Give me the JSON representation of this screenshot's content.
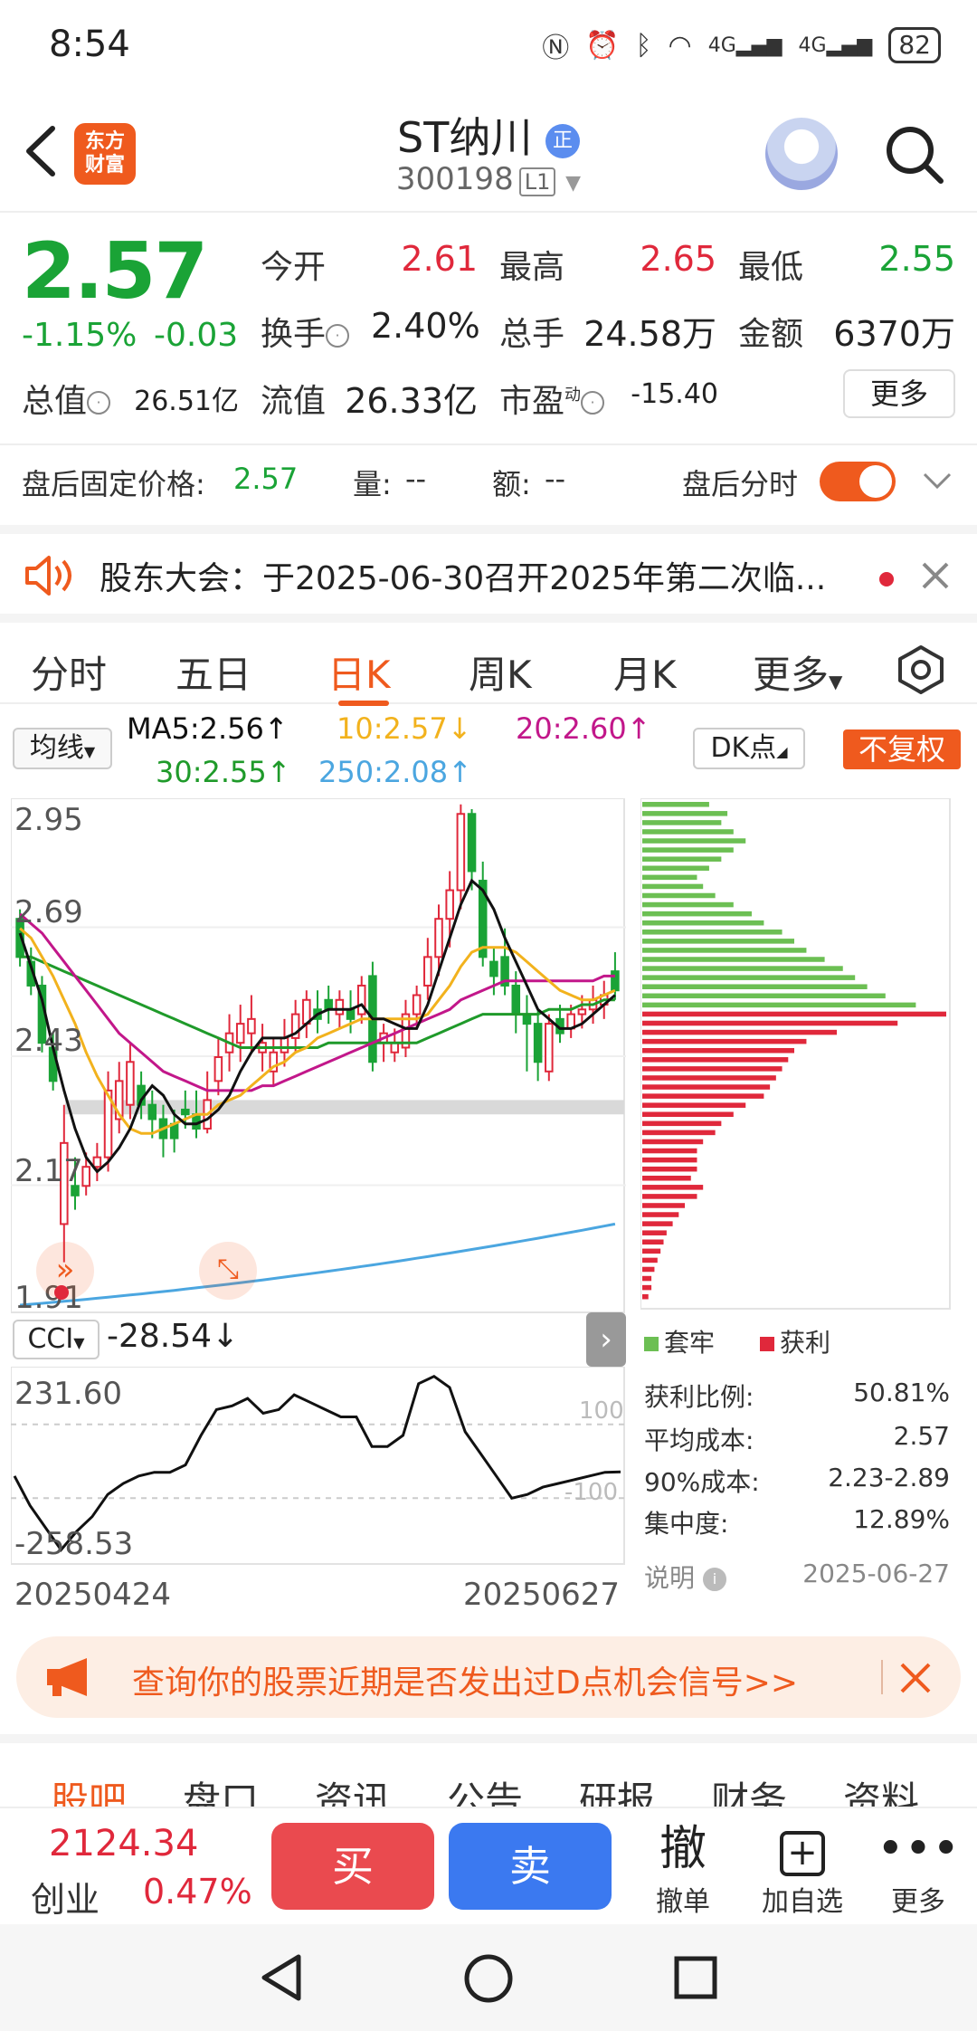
{
  "status_bar": {
    "time": "8:54",
    "signal1": "4G",
    "signal2": "4G",
    "battery": "82"
  },
  "header": {
    "logo_line1": "东方",
    "logo_line2": "财富",
    "stock_name": "ST纳川",
    "name_badge": "正",
    "stock_code": "300198",
    "code_badge": "L1"
  },
  "quote": {
    "price": "2.57",
    "pct": "-1.15%",
    "chg": "-0.03",
    "open_label": "今开",
    "open": "2.61",
    "high_label": "最高",
    "high": "2.65",
    "low_label": "最低",
    "low": "2.55",
    "turnover_label": "换手",
    "turnover": "2.40%",
    "volume_label": "总手",
    "volume": "24.58万",
    "amount_label": "金额",
    "amount": "6370万",
    "mktcap_label": "总值",
    "mktcap": "26.51亿",
    "float_label": "流值",
    "float": "26.33亿",
    "pe_label": "市盈",
    "pe_sup": "动",
    "pe": "-15.40",
    "more_label": "更多",
    "colors": {
      "up": "#e0283b",
      "down": "#1aa336",
      "accent": "#ef5a1e"
    }
  },
  "after_hours": {
    "price_label": "盘后固定价格:",
    "price": "2.57",
    "vol_label": "量:",
    "vol": "--",
    "amt_label": "额:",
    "amt": "--",
    "toggle_label": "盘后分时",
    "toggle_on": true
  },
  "notice": {
    "text": "股东大会：于2025-06-30召开2025年第二次临..."
  },
  "tabs": [
    "分时",
    "五日",
    "日K",
    "周K",
    "月K",
    "更多"
  ],
  "active_tab": "日K",
  "ma": {
    "selector": "均线",
    "ma5": "MA5:2.56↑",
    "ma10": "10:2.57↓",
    "ma20": "20:2.60↑",
    "ma30": "30:2.55↑",
    "ma250": "250:2.08↑",
    "dk_label": "DK点",
    "adjust_label": "不复权",
    "colors": {
      "ma5": "#111111",
      "ma10": "#f2b21d",
      "ma20": "#c2178a",
      "ma30": "#1f9a2a",
      "ma250": "#4ba6e0"
    }
  },
  "kline_axis": {
    "y_labels": [
      "2.95",
      "2.69",
      "2.43",
      "2.17",
      "1.91"
    ],
    "ylim": [
      1.91,
      2.95
    ]
  },
  "chart_data": {
    "type": "candlestick",
    "x_range": [
      "20250424",
      "20250627"
    ],
    "ylim": [
      1.91,
      2.95
    ],
    "candles": [
      {
        "o": 2.72,
        "h": 2.74,
        "c": 2.64,
        "l": 2.62
      },
      {
        "o": 2.63,
        "h": 2.66,
        "c": 2.58,
        "l": 2.56
      },
      {
        "o": 2.58,
        "h": 2.6,
        "c": 2.46,
        "l": 2.44
      },
      {
        "o": 2.45,
        "h": 2.48,
        "c": 2.38,
        "l": 2.36
      },
      {
        "o": 2.08,
        "h": 2.33,
        "c": 2.25,
        "l": 2.0
      },
      {
        "o": 2.16,
        "h": 2.22,
        "c": 2.14,
        "l": 2.11
      },
      {
        "o": 2.16,
        "h": 2.23,
        "c": 2.2,
        "l": 2.14
      },
      {
        "o": 2.2,
        "h": 2.25,
        "c": 2.22,
        "l": 2.17
      },
      {
        "o": 2.22,
        "h": 2.4,
        "c": 2.36,
        "l": 2.19
      },
      {
        "o": 2.3,
        "h": 2.42,
        "c": 2.38,
        "l": 2.27
      },
      {
        "o": 2.33,
        "h": 2.46,
        "c": 2.42,
        "l": 2.3
      },
      {
        "o": 2.37,
        "h": 2.4,
        "c": 2.33,
        "l": 2.3
      },
      {
        "o": 2.33,
        "h": 2.36,
        "c": 2.3,
        "l": 2.26
      },
      {
        "o": 2.3,
        "h": 2.33,
        "c": 2.26,
        "l": 2.22
      },
      {
        "o": 2.29,
        "h": 2.32,
        "c": 2.26,
        "l": 2.23
      },
      {
        "o": 2.32,
        "h": 2.36,
        "c": 2.31,
        "l": 2.28
      },
      {
        "o": 2.31,
        "h": 2.36,
        "c": 2.28,
        "l": 2.26
      },
      {
        "o": 2.28,
        "h": 2.4,
        "c": 2.34,
        "l": 2.27
      },
      {
        "o": 2.38,
        "h": 2.47,
        "c": 2.43,
        "l": 2.35
      },
      {
        "o": 2.44,
        "h": 2.52,
        "c": 2.48,
        "l": 2.4
      },
      {
        "o": 2.46,
        "h": 2.54,
        "c": 2.5,
        "l": 2.42
      },
      {
        "o": 2.48,
        "h": 2.56,
        "c": 2.51,
        "l": 2.44
      },
      {
        "o": 2.44,
        "h": 2.5,
        "c": 2.46,
        "l": 2.4
      },
      {
        "o": 2.4,
        "h": 2.47,
        "c": 2.44,
        "l": 2.37
      },
      {
        "o": 2.44,
        "h": 2.51,
        "c": 2.47,
        "l": 2.41
      },
      {
        "o": 2.47,
        "h": 2.55,
        "c": 2.52,
        "l": 2.44
      },
      {
        "o": 2.5,
        "h": 2.57,
        "c": 2.55,
        "l": 2.47
      },
      {
        "o": 2.53,
        "h": 2.57,
        "c": 2.51,
        "l": 2.48
      },
      {
        "o": 2.55,
        "h": 2.58,
        "c": 2.53,
        "l": 2.5
      },
      {
        "o": 2.52,
        "h": 2.57,
        "c": 2.55,
        "l": 2.49
      },
      {
        "o": 2.53,
        "h": 2.57,
        "c": 2.51,
        "l": 2.48
      },
      {
        "o": 2.52,
        "h": 2.6,
        "c": 2.58,
        "l": 2.5
      },
      {
        "o": 2.6,
        "h": 2.63,
        "c": 2.42,
        "l": 2.4
      },
      {
        "o": 2.46,
        "h": 2.5,
        "c": 2.48,
        "l": 2.42
      },
      {
        "o": 2.44,
        "h": 2.49,
        "c": 2.46,
        "l": 2.42
      },
      {
        "o": 2.45,
        "h": 2.55,
        "c": 2.52,
        "l": 2.43
      },
      {
        "o": 2.52,
        "h": 2.58,
        "c": 2.56,
        "l": 2.49
      },
      {
        "o": 2.58,
        "h": 2.68,
        "c": 2.64,
        "l": 2.55
      },
      {
        "o": 2.64,
        "h": 2.75,
        "c": 2.72,
        "l": 2.6
      },
      {
        "o": 2.72,
        "h": 2.82,
        "c": 2.78,
        "l": 2.66
      },
      {
        "o": 2.78,
        "h": 2.96,
        "c": 2.94,
        "l": 2.74
      },
      {
        "o": 2.94,
        "h": 2.95,
        "c": 2.82,
        "l": 2.78
      },
      {
        "o": 2.8,
        "h": 2.84,
        "c": 2.64,
        "l": 2.62
      },
      {
        "o": 2.63,
        "h": 2.66,
        "c": 2.6,
        "l": 2.56
      },
      {
        "o": 2.64,
        "h": 2.7,
        "c": 2.58,
        "l": 2.56
      },
      {
        "o": 2.58,
        "h": 2.61,
        "c": 2.52,
        "l": 2.48
      },
      {
        "o": 2.52,
        "h": 2.56,
        "c": 2.5,
        "l": 2.4
      },
      {
        "o": 2.5,
        "h": 2.53,
        "c": 2.42,
        "l": 2.38
      },
      {
        "o": 2.4,
        "h": 2.52,
        "c": 2.5,
        "l": 2.38
      },
      {
        "o": 2.51,
        "h": 2.54,
        "c": 2.48,
        "l": 2.46
      },
      {
        "o": 2.49,
        "h": 2.54,
        "c": 2.52,
        "l": 2.47
      },
      {
        "o": 2.52,
        "h": 2.56,
        "c": 2.53,
        "l": 2.49
      },
      {
        "o": 2.53,
        "h": 2.58,
        "c": 2.55,
        "l": 2.5
      },
      {
        "o": 2.54,
        "h": 2.59,
        "c": 2.56,
        "l": 2.51
      },
      {
        "o": 2.61,
        "h": 2.65,
        "c": 2.57,
        "l": 2.55
      }
    ],
    "ma5": [
      2.69,
      2.62,
      2.55,
      2.45,
      2.36,
      2.28,
      2.22,
      2.19,
      2.21,
      2.24,
      2.28,
      2.34,
      2.37,
      2.35,
      2.31,
      2.29,
      2.29,
      2.3,
      2.32,
      2.35,
      2.4,
      2.44,
      2.47,
      2.47,
      2.47,
      2.48,
      2.5,
      2.52,
      2.53,
      2.53,
      2.53,
      2.54,
      2.51,
      2.51,
      2.5,
      2.49,
      2.49,
      2.54,
      2.61,
      2.68,
      2.75,
      2.8,
      2.78,
      2.74,
      2.68,
      2.63,
      2.58,
      2.53,
      2.51,
      2.49,
      2.49,
      2.5,
      2.52,
      2.54,
      2.56
    ],
    "ma10": [
      2.7,
      2.68,
      2.64,
      2.6,
      2.55,
      2.5,
      2.44,
      2.39,
      2.35,
      2.31,
      2.28,
      2.27,
      2.27,
      2.28,
      2.29,
      2.3,
      2.31,
      2.31,
      2.33,
      2.34,
      2.35,
      2.37,
      2.39,
      2.41,
      2.42,
      2.44,
      2.45,
      2.47,
      2.48,
      2.49,
      2.5,
      2.51,
      2.51,
      2.51,
      2.51,
      2.51,
      2.51,
      2.52,
      2.55,
      2.58,
      2.62,
      2.65,
      2.66,
      2.66,
      2.66,
      2.65,
      2.63,
      2.61,
      2.59,
      2.57,
      2.56,
      2.55,
      2.55,
      2.56,
      2.57
    ],
    "ma20": [
      2.73,
      2.71,
      2.69,
      2.66,
      2.63,
      2.6,
      2.57,
      2.54,
      2.51,
      2.48,
      2.46,
      2.44,
      2.42,
      2.4,
      2.39,
      2.38,
      2.37,
      2.36,
      2.36,
      2.36,
      2.36,
      2.36,
      2.37,
      2.37,
      2.38,
      2.39,
      2.4,
      2.41,
      2.42,
      2.43,
      2.44,
      2.45,
      2.46,
      2.47,
      2.48,
      2.49,
      2.5,
      2.51,
      2.52,
      2.53,
      2.55,
      2.56,
      2.57,
      2.58,
      2.59,
      2.59,
      2.59,
      2.59,
      2.59,
      2.59,
      2.59,
      2.59,
      2.59,
      2.6,
      2.6
    ],
    "ma30": [
      2.64,
      2.64,
      2.63,
      2.62,
      2.61,
      2.6,
      2.59,
      2.58,
      2.57,
      2.56,
      2.55,
      2.54,
      2.53,
      2.52,
      2.51,
      2.5,
      2.49,
      2.48,
      2.47,
      2.46,
      2.45,
      2.45,
      2.45,
      2.45,
      2.45,
      2.45,
      2.45,
      2.45,
      2.46,
      2.46,
      2.46,
      2.46,
      2.46,
      2.46,
      2.46,
      2.46,
      2.46,
      2.47,
      2.48,
      2.49,
      2.5,
      2.51,
      2.52,
      2.52,
      2.52,
      2.52,
      2.52,
      2.52,
      2.53,
      2.53,
      2.53,
      2.54,
      2.54,
      2.55,
      2.55
    ],
    "ma250_start": 1.91,
    "ma250_end": 2.08,
    "support_band": [
      2.31,
      2.34
    ]
  },
  "chip": {
    "legend_trapped": "套牢",
    "legend_profit": "获利",
    "profit_ratio_label": "获利比例:",
    "profit_ratio": "50.81%",
    "avg_cost_label": "平均成本:",
    "avg_cost": "2.57",
    "cost90_label": "90%成本:",
    "cost90": "2.23-2.89",
    "concentration_label": "集中度:",
    "concentration": "12.89%",
    "note_label": "说明",
    "date": "2025-06-27",
    "profit_bars": [
      0.22,
      0.28,
      0.26,
      0.3,
      0.34,
      0.3,
      0.26,
      0.22,
      0.18,
      0.2,
      0.24,
      0.3,
      0.36,
      0.4,
      0.46,
      0.5,
      0.54,
      0.6,
      0.66,
      0.7,
      0.74,
      0.8,
      0.9
    ],
    "trapped_bars": [
      1.0,
      0.84,
      0.64,
      0.54,
      0.5,
      0.48,
      0.46,
      0.44,
      0.42,
      0.4,
      0.34,
      0.3,
      0.26,
      0.24,
      0.2,
      0.18,
      0.18,
      0.18,
      0.16,
      0.2,
      0.18,
      0.14,
      0.12,
      0.1,
      0.08,
      0.07,
      0.06,
      0.05,
      0.04,
      0.03,
      0.03,
      0.02
    ]
  },
  "cci": {
    "selector": "CCI",
    "value": "-28.54↓",
    "top_label": "231.60",
    "bottom_label": "-258.53",
    "line_100": "100",
    "line_m100": "-100",
    "ylim": [
      -258.53,
      231.6
    ],
    "values": [
      -40,
      -120,
      -180,
      -240,
      -190,
      -150,
      -90,
      -60,
      -40,
      -30,
      -30,
      -10,
      70,
      140,
      150,
      170,
      130,
      140,
      180,
      160,
      140,
      120,
      120,
      40,
      40,
      70,
      210,
      230,
      200,
      80,
      20,
      -40,
      -100,
      -90,
      -70,
      -60,
      -50,
      -40,
      -30,
      -28.54
    ]
  },
  "x_labels": {
    "start": "20250424",
    "end": "20250627"
  },
  "ad": {
    "text": "查询你的股票近期是否发出过D点机会信号>>"
  },
  "sub_tabs": [
    "股吧",
    "盘口",
    "资讯",
    "公告",
    "研报",
    "财务",
    "资料"
  ],
  "active_sub_tab": "股吧",
  "trade_bar": {
    "index_value": "2124.34",
    "index_name": "创业",
    "index_pct": "0.47%",
    "buy": "买",
    "sell": "卖",
    "cancel_icon": "撤",
    "cancel": "撤单",
    "add_watch": "加自选",
    "more": "更多"
  }
}
